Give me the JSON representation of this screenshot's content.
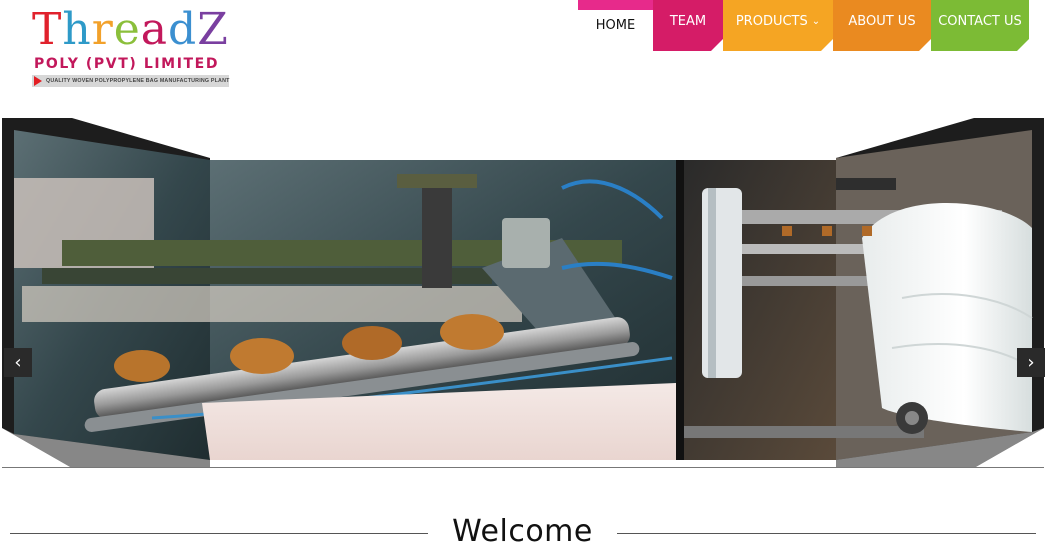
{
  "logo": {
    "word_letters": [
      {
        "ch": "T",
        "color": "#e0212c"
      },
      {
        "ch": "h",
        "color": "#2e9ac8"
      },
      {
        "ch": "r",
        "color": "#f2a12a"
      },
      {
        "ch": "e",
        "color": "#8bbf3b"
      },
      {
        "ch": "a",
        "color": "#c2185b"
      },
      {
        "ch": "d",
        "color": "#3b8fd0"
      },
      {
        "ch": "Z",
        "color": "#7a3fa0"
      }
    ],
    "subtitle": "POLY (PVT) LIMITED",
    "tagline": "QUALITY WOVEN POLYPROPYLENE BAG MANUFACTURING PLANT"
  },
  "nav": {
    "home": "HOME",
    "team": "TEAM",
    "products": "PRODUCTS",
    "about": "ABOUT US",
    "contact": "CONTACT US"
  },
  "icons": {
    "prev": "chevron-left-icon",
    "next": "chevron-right-icon",
    "dropdown": "chevron-down-icon"
  },
  "colors": {
    "home_accent": "#e72a8b",
    "team": "#d51c67",
    "products": "#f5a523",
    "about": "#ea8a20",
    "contact": "#7cbb35"
  },
  "slider": {
    "prev_glyph": "‹",
    "next_glyph": "›"
  },
  "welcome": {
    "heading": "Welcome"
  }
}
